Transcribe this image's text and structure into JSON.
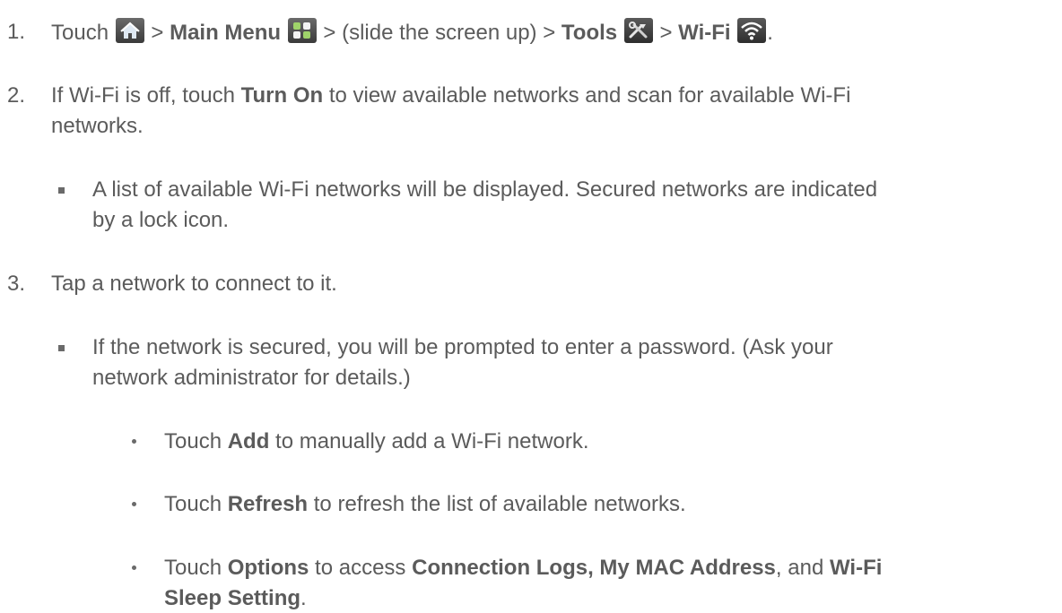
{
  "steps": [
    {
      "num": "1.",
      "parts": {
        "touch": "Touch",
        "sep1": ">",
        "main_menu": "Main Menu",
        "sep2": "> (slide the screen up) >",
        "tools": "Tools",
        "sep3": ">",
        "wifi": "Wi-Fi",
        "end": "."
      },
      "icons": [
        "home-icon",
        "main-menu-icon",
        "tools-icon",
        "wifi-icon"
      ]
    },
    {
      "num": "2.",
      "line1_pre": "If Wi-Fi is off, touch",
      "line1_bold": "Turn On",
      "line1_post": "to view available networks and scan for available Wi-Fi",
      "line2": "networks."
    },
    {
      "bullet_line1": "A list of available Wi-Fi networks will be displayed. Secured networks are indicated",
      "bullet_line2": "by a lock icon."
    },
    {
      "num": "3.",
      "text": "Tap a network to connect to it."
    },
    {
      "bullet_line1": "If the network is secured, you will be prompted to enter a password. (Ask your",
      "bullet_line2": "network administrator for details.)"
    }
  ],
  "sub": [
    {
      "pre": "Touch",
      "bold": "Add",
      "post": "to manually add a Wi-Fi network."
    },
    {
      "pre": "Touch",
      "bold": "Refresh",
      "post": "to refresh the list of available networks."
    },
    {
      "pre": "Touch",
      "bold": "Options",
      "mid": "to access",
      "bold2": "Connection Logs, My MAC Address",
      "mid2": ", and",
      "bold3": "Wi-Fi",
      "line2_bold": "Sleep Setting",
      "line2_end": "."
    }
  ],
  "colors": {
    "text": "#5b5b5b",
    "icon_bg": "#4a4a4a"
  }
}
